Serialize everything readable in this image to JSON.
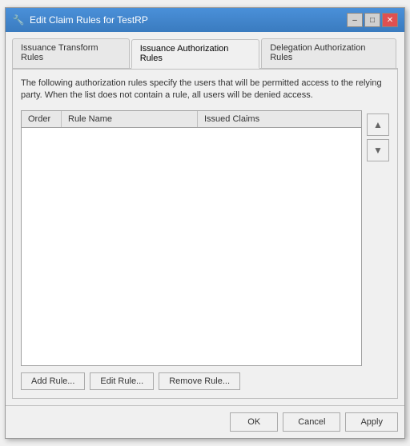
{
  "window": {
    "title": "Edit Claim Rules for TestRP",
    "icon": "🔧"
  },
  "title_buttons": {
    "minimize": "–",
    "maximize": "□",
    "close": "✕"
  },
  "tabs": [
    {
      "label": "Issuance Transform Rules",
      "active": false
    },
    {
      "label": "Issuance Authorization Rules",
      "active": true
    },
    {
      "label": "Delegation Authorization Rules",
      "active": false
    }
  ],
  "description": "The following authorization rules specify the users that will be permitted access to the relying party. When the list does not contain a rule, all users will be denied access.",
  "table": {
    "columns": [
      "Order",
      "Rule Name",
      "Issued Claims"
    ]
  },
  "buttons": {
    "add_rule": "Add Rule...",
    "edit_rule": "Edit Rule...",
    "remove_rule": "Remove Rule..."
  },
  "bottom_buttons": {
    "ok": "OK",
    "cancel": "Cancel",
    "apply": "Apply"
  },
  "arrow_up": "▲",
  "arrow_down": "▼"
}
